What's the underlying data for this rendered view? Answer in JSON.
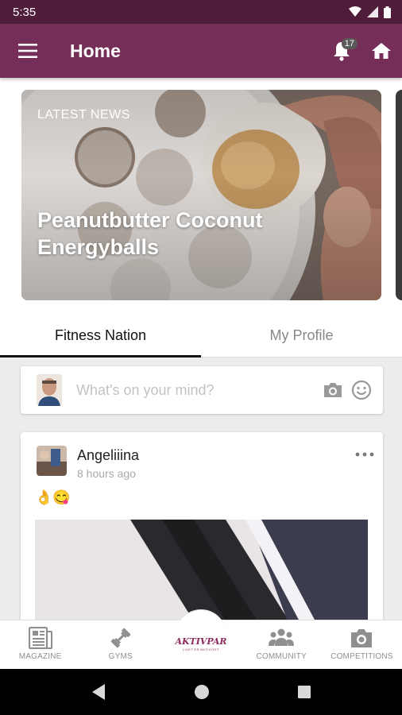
{
  "status_bar": {
    "time": "5:35"
  },
  "app_bar": {
    "title": "Home",
    "notification_count": "17"
  },
  "news": {
    "kicker": "LATEST NEWS",
    "headline": "Peanutbutter Coconut Energyballs"
  },
  "tabs": [
    {
      "label": "Fitness Nation",
      "active": true
    },
    {
      "label": "My Profile",
      "active": false
    }
  ],
  "composer": {
    "placeholder": "What's on your mind?"
  },
  "post": {
    "author": "Angeliiina",
    "time": "8 hours ago",
    "text": "👌😋"
  },
  "bottom_nav": {
    "items": [
      {
        "label": "MAGAZINE",
        "icon": "magazine-icon"
      },
      {
        "label": "GYMS",
        "icon": "dumbbell-icon"
      },
      {
        "label": "",
        "icon": "aktivpar-logo"
      },
      {
        "label": "COMMUNITY",
        "icon": "community-icon"
      },
      {
        "label": "COMPETITIONS",
        "icon": "camera-icon"
      }
    ],
    "brand": "AKTIVPAR",
    "brand_tagline": "LIVET ER AKTIVITET"
  },
  "colors": {
    "primary": "#752e58",
    "status_bar": "#4f1c3a",
    "accent": "#8c2a5d"
  }
}
